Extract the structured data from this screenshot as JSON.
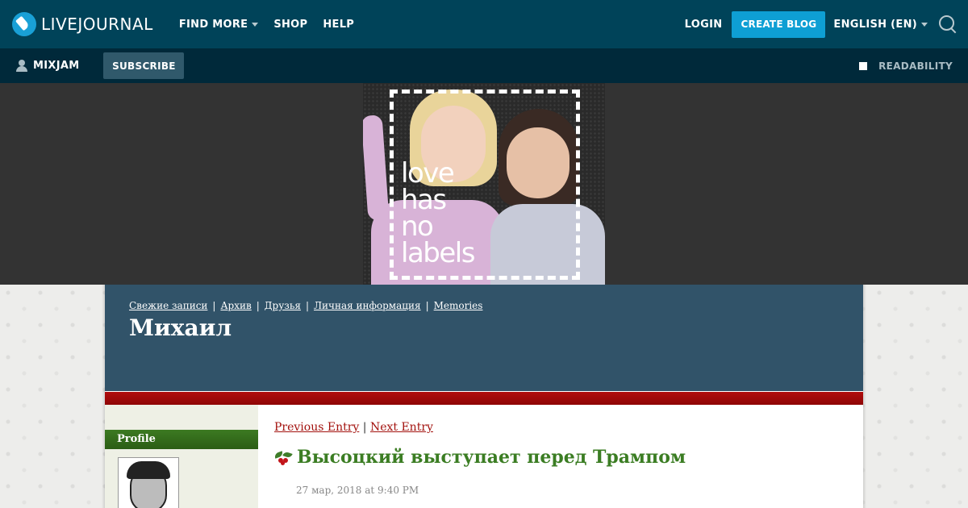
{
  "topbar": {
    "logo_text": "LIVEJOURNAL",
    "nav": [
      "FIND MORE",
      "SHOP",
      "HELP"
    ],
    "login": "LOGIN",
    "create_blog": "CREATE BLOG",
    "language": "ENGLISH (EN)"
  },
  "subbar": {
    "username": "MIXJAM",
    "subscribe": "SUBSCRIBE",
    "readability": "READABILITY"
  },
  "banner": {
    "ad_text_lines": [
      "love",
      "has",
      "no",
      "labels"
    ]
  },
  "journal": {
    "nav": [
      "Свежие записи",
      "Архив",
      "Друзья",
      "Личная информация",
      "Memories"
    ],
    "title": "Михаил"
  },
  "sidebar": {
    "profile_heading": "Profile"
  },
  "entry": {
    "previous": "Previous Entry",
    "separator": "|",
    "next": "Next Entry",
    "title": "Высоцкий выступает перед Трампом",
    "date": "27 мар, 2018 at 9:40 PM"
  },
  "colors": {
    "topbar_bg": "#004359",
    "subbar_bg": "#00293a",
    "accent_blue": "#0e9fd4",
    "journal_header_bg": "#315369",
    "red_stripe": "#b00d0d",
    "sidebar_heading": "#3c7a22",
    "entry_link": "#a3120e",
    "entry_title": "#3b7d23"
  }
}
